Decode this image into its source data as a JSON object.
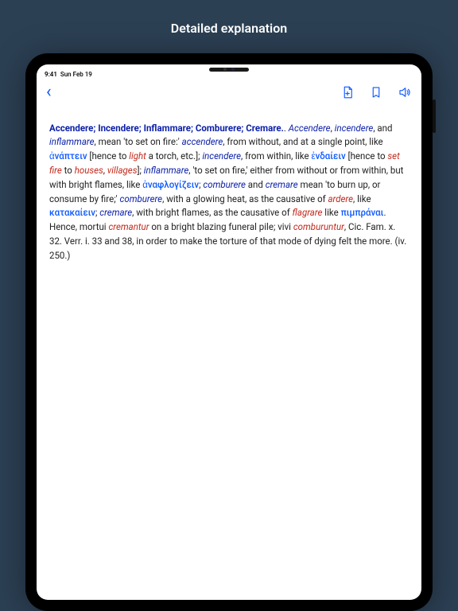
{
  "caption": "Detailed explanation",
  "statusbar": {
    "time": "9:41",
    "date": "Sun Feb 19"
  },
  "navbar": {
    "back_glyph": "‹"
  },
  "entry": {
    "headwords": "Accendere; Incendere; Inflammare; Comburere; Cremare.",
    "p1_a": ". ",
    "p1_b": ", ",
    "p1_c": ", and ",
    "p1_d": ", mean 'to set on fire:' ",
    "p1_e": ", from without, and at a single point, like ",
    "p1_f": " [hence to ",
    "p1_g": " a torch, etc.]; ",
    "p1_h": ", from within, like ",
    "p1_i": " [hence to ",
    "p1_j": " to ",
    "p1_k": ", ",
    "p1_l": "]; ",
    "p1_m": ", 'to set on fire,' either from without or from within, but with bright flames, like ",
    "p1_n": "; ",
    "p1_o": " and ",
    "p1_p": " mean 'to burn up, or consume by fire;' ",
    "p1_q": ", with a glowing heat, as the causative of ",
    "p1_r": ", like ",
    "p1_s": "; ",
    "p1_t": ", with bright flames, as the causative of ",
    "p1_u": " like ",
    "p1_v": ". Hence, mortui ",
    "p1_w": " on a bright blazing funeral pile; vivi ",
    "p1_x": ", Cic. Fam. x. 32. Verr. i. 33 and 38, in order to make the torture of that mode of dying felt the more. (iv. 250.)",
    "w": {
      "accendere_1": "Accendere",
      "incendere_1": "incendere",
      "inflammare_1": "inflammare",
      "accendere_2": "accendere",
      "incendere_2": "incendere",
      "inflammare_2": "inflammare",
      "comburere_1": "comburere",
      "cremare_1": "cremare",
      "comburere_2": "comburere",
      "cremare_2": "cremare",
      "light": "light",
      "set_fire": "set fire",
      "houses": "houses",
      "villages": "villages",
      "ardere": "ardere",
      "flagrare": "flagrare",
      "cremantur": "cremantur",
      "comburuntur": "comburuntur",
      "anaptein": "ἀνάπτειν",
      "endaiein": "ἐνδαίειν",
      "anaphlogizein": "ἀναφλογίζειν",
      "katakaiein": "κατακαίειν",
      "pimpranai": "πιμπράναι"
    }
  }
}
